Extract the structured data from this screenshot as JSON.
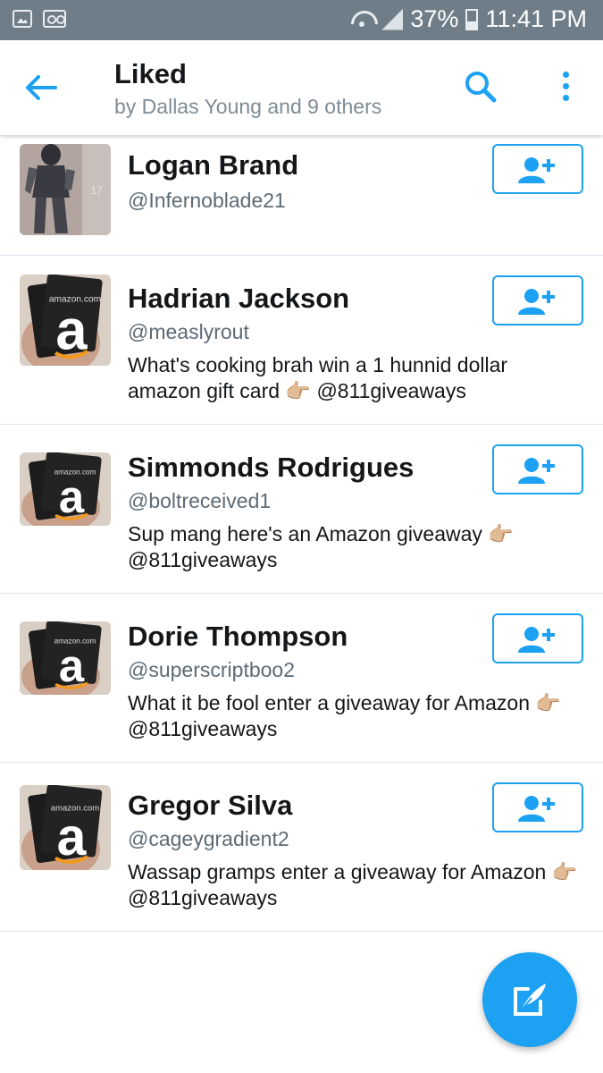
{
  "status_bar": {
    "battery": "37%",
    "time": "11:41 PM",
    "icons": [
      "gallery-icon",
      "voicemail-icon",
      "wifi-icon",
      "signal-icon",
      "battery-icon"
    ]
  },
  "header": {
    "title": "Liked",
    "subtitle": "by Dallas Young and 9 others",
    "icons": [
      "back-arrow-icon",
      "search-icon",
      "more-vertical-icon"
    ]
  },
  "users": [
    {
      "name": "Logan Brand",
      "handle": "@Infernoblade21",
      "bio": "",
      "avatar": "knight"
    },
    {
      "name": "Hadrian Jackson",
      "handle": "@measlyrout",
      "bio": "What's cooking brah win a 1 hunnid dollar amazon gift card 👉🏼 @811giveaways",
      "avatar": "amazon"
    },
    {
      "name": "Simmonds Rodrigues",
      "handle": "@boltreceived1",
      "bio": "Sup mang here's an Amazon giveaway 👉🏼 @811giveaways",
      "avatar": "amazon"
    },
    {
      "name": "Dorie Thompson",
      "handle": "@superscriptboo2",
      "bio": "What it be fool enter a giveaway for Amazon 👉🏼 @811giveaways",
      "avatar": "amazon"
    },
    {
      "name": "Gregor Silva",
      "handle": "@cageygradient2",
      "bio": "Wassap gramps enter a giveaway for Amazon 👉🏼 @811giveaways",
      "avatar": "amazon"
    }
  ],
  "fab": {
    "icon": "compose-tweet-icon"
  },
  "colors": {
    "accent": "#1da1f2",
    "status_bar": "#6e7d88",
    "text": "#14171a",
    "secondary_text": "#5d6a75"
  }
}
